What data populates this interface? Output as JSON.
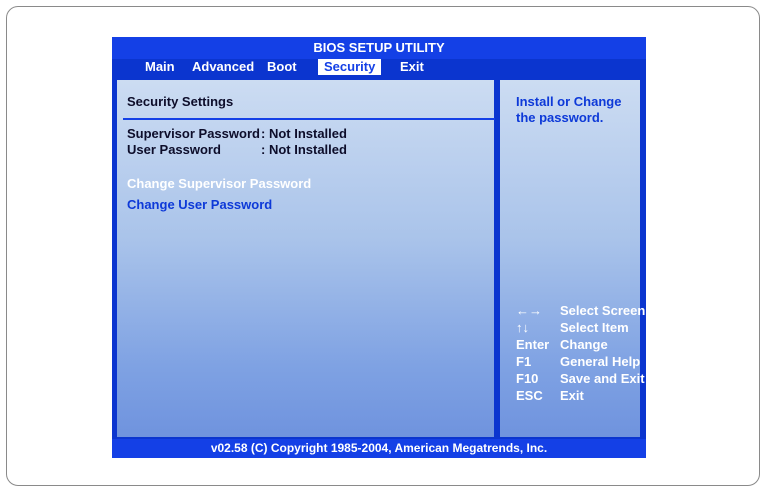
{
  "bios": {
    "title": "BIOS SETUP UTILITY",
    "menu": [
      {
        "label": "Main",
        "active": false
      },
      {
        "label": "Advanced",
        "active": false
      },
      {
        "label": "Boot",
        "active": false
      },
      {
        "label": "Security",
        "active": true
      },
      {
        "label": "Exit",
        "active": false
      }
    ],
    "section_title": "Security Settings",
    "status_rows": [
      {
        "label": "Supervisor Password",
        "value": ": Not Installed"
      },
      {
        "label": "User Password",
        "value": ": Not Installed"
      }
    ],
    "options": [
      {
        "label": "Change Supervisor Password",
        "color": "#ffffff"
      },
      {
        "label": "Change User Password",
        "color": "#0d39d8"
      }
    ],
    "help_text": "Install or Change the password.",
    "keys": [
      {
        "key": "←→",
        "action": "Select Screen"
      },
      {
        "key": "↑↓",
        "action": "Select Item"
      },
      {
        "key": "Enter",
        "action": "Change"
      },
      {
        "key": "F1",
        "action": "General Help"
      },
      {
        "key": "F10",
        "action": "Save and Exit"
      },
      {
        "key": "ESC",
        "action": "Exit"
      }
    ],
    "footer": "v02.58 (C) Copyright 1985-2004, American Megatrends, Inc."
  },
  "colors": {
    "bios_blue": "#0b35cf",
    "highlight_blue": "#1440e6",
    "panel_light": "#ccdcf2",
    "text_dark": "#0d0d2a"
  }
}
